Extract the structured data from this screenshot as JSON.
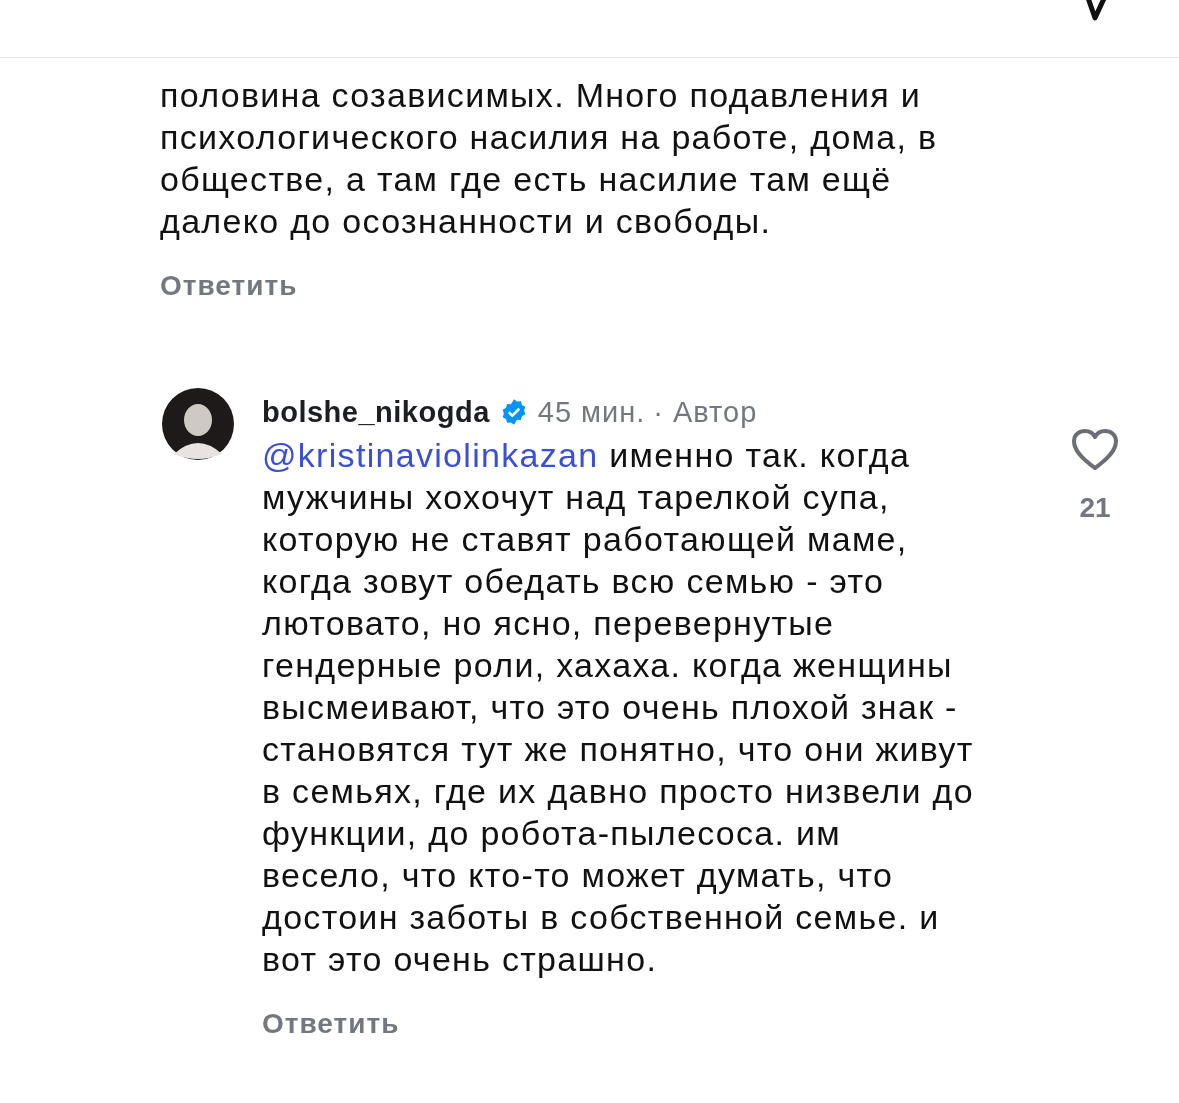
{
  "comments": [
    {
      "lines": [
        "половина созависимых. Много подавления и",
        "психологического насилия на работе, дома, в",
        "обществе, а там где есть насилие там ещё",
        "далеко до осознанности и свободы."
      ],
      "reply": "Ответить"
    },
    {
      "username": "bolshe_nikogda",
      "verified": true,
      "time": "45 мин.",
      "author_tag": "· Автор",
      "mention": "@kristinaviolinkazan",
      "lines": [
        " именно так. когда",
        "мужчины хохочут над тарелкой супа,",
        "которую не ставят работающей маме,",
        "когда зовут обедать всю семью - это",
        "лютовато, но ясно, перевернутые",
        "гендерные роли, хахаха. когда женщины",
        "высмеивают, что это очень плохой знак -",
        "становятся тут же понятно, что они живут",
        "в семьях, где их давно просто низвели до",
        "функции, до робота-пылесоса. им",
        "весело, что кто-то может думать, что",
        "достоин заботы в собственной семье. и",
        "вот это очень страшно."
      ],
      "reply": "Ответить",
      "likes": "21"
    }
  ]
}
